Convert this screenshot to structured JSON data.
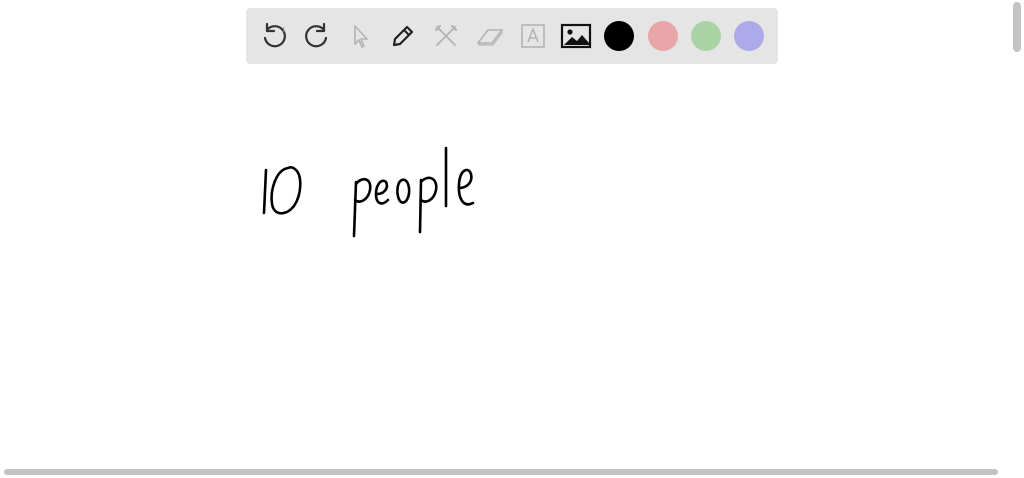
{
  "toolbar": {
    "tools": [
      {
        "name": "undo",
        "icon": "undo-icon"
      },
      {
        "name": "redo",
        "icon": "redo-icon"
      },
      {
        "name": "select",
        "icon": "pointer-icon"
      },
      {
        "name": "pen",
        "icon": "pencil-icon"
      },
      {
        "name": "tools",
        "icon": "crossed-tools-icon"
      },
      {
        "name": "eraser",
        "icon": "eraser-icon"
      },
      {
        "name": "text",
        "icon": "text-box-icon"
      },
      {
        "name": "image",
        "icon": "image-icon"
      }
    ],
    "colors": [
      "#000000",
      "#e8a6a9",
      "#a9d3a4",
      "#aeaaea"
    ],
    "selected_color": "#000000"
  },
  "canvas": {
    "handwriting": "10 people",
    "ink_color": "#000000"
  }
}
